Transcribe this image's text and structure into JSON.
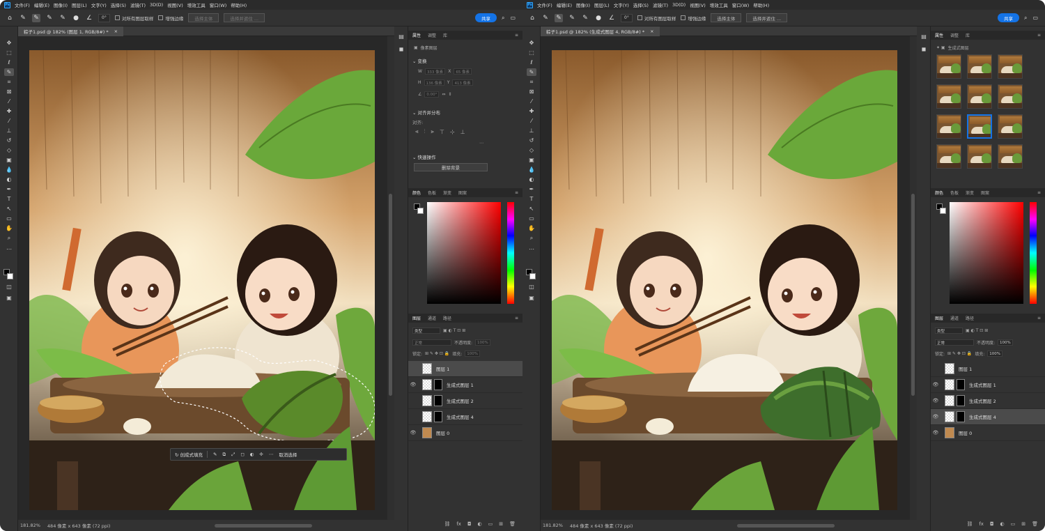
{
  "menu": [
    "文件(F)",
    "编辑(E)",
    "图像(I)",
    "图层(L)",
    "文字(Y)",
    "选择(S)",
    "滤镜(T)",
    "3D(D)",
    "视图(V)",
    "增效工具",
    "窗口(W)",
    "帮助(H)"
  ],
  "options": {
    "angle": "0°",
    "sample_all": "对所有图层取样",
    "enhance": "增强边缘",
    "select_subject": "选择主体",
    "select_mask": "选择并遮住 ...",
    "share": "共享",
    "brush_size": "30"
  },
  "left": {
    "doc_tab": "粽子1.psd @ 182% (图层 1, RGB/8#) *",
    "status_zoom": "181.82%",
    "status_size": "484 像素 x 643 像素 (72 ppi)",
    "panel_tabs": [
      "属性",
      "调整",
      "库"
    ],
    "pixel_layer": "像素图层",
    "transform": "变换",
    "tf_w": "333 像素",
    "tf_x": "65 像素",
    "tf_h": "136 像素",
    "tf_y": "413 像素",
    "tf_angle": "0.00°",
    "align": "对齐并分布",
    "align_sub": "对齐:",
    "quick": "快速操作",
    "remove_bg": "删除背景",
    "color_tabs": [
      "颜色",
      "色板",
      "渐变",
      "图案"
    ],
    "layers_tabs": [
      "图层",
      "通道",
      "路径"
    ],
    "kind": "类型",
    "blend": "正常",
    "opacity_label": "不透明度:",
    "opacity": "100%",
    "lock_label": "锁定:",
    "fill_label": "填充:",
    "fill": "100%",
    "layers": [
      {
        "name": "图层 1",
        "eye": "",
        "selected": true,
        "mask": false
      },
      {
        "name": "生成式图层 1",
        "eye": "👁",
        "selected": false,
        "mask": true
      },
      {
        "name": "生成式图层 2",
        "eye": "",
        "selected": false,
        "mask": true
      },
      {
        "name": "生成式图层 4",
        "eye": "",
        "selected": false,
        "mask": true
      },
      {
        "name": "图层 0",
        "eye": "👁",
        "selected": false,
        "mask": false
      }
    ],
    "ctx_fill": "创成式填充",
    "ctx_cancel": "取消选择"
  },
  "right": {
    "doc_tab": "粽子1.psd @ 182% (生成式图层 4, RGB/8#) *",
    "status_zoom": "181.82%",
    "status_size": "484 像素 x 643 像素 (72 ppi)",
    "panel_tabs": [
      "属性",
      "调整",
      "库"
    ],
    "gen_layer": "生成式图层",
    "color_tabs": [
      "颜色",
      "色板",
      "渐变",
      "图案"
    ],
    "layers_tabs": [
      "图层",
      "通道",
      "路径"
    ],
    "kind": "类型",
    "blend": "正常",
    "opacity_label": "不透明度:",
    "opacity": "100%",
    "lock_label": "锁定:",
    "fill_label": "填充:",
    "fill": "100%",
    "layers": [
      {
        "name": "图层 1",
        "eye": "",
        "selected": false,
        "mask": false
      },
      {
        "name": "生成式图层 1",
        "eye": "👁",
        "selected": false,
        "mask": true
      },
      {
        "name": "生成式图层 2",
        "eye": "👁",
        "selected": false,
        "mask": true
      },
      {
        "name": "生成式图层 4",
        "eye": "👁",
        "selected": true,
        "mask": true
      },
      {
        "name": "图层 0",
        "eye": "👁",
        "selected": false,
        "mask": false
      }
    ]
  }
}
